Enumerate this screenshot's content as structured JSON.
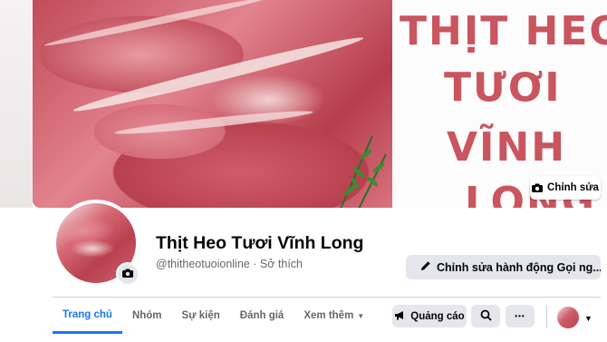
{
  "cover": {
    "text_lines": [
      "THỊT HEO",
      "TƯƠI",
      "VĨNH",
      "LONG"
    ],
    "edit_label": "Chỉnh sửa"
  },
  "profile": {
    "name": "Thịt Heo Tươi Vĩnh Long",
    "username": "@thitheotuoionline",
    "separator": "·",
    "category": "Sở thích"
  },
  "actions": {
    "edit_action_label": "Chỉnh sửa hành động Gọi ng..."
  },
  "tabs": [
    {
      "label": "Trang chủ",
      "active": true
    },
    {
      "label": "Nhóm"
    },
    {
      "label": "Sự kiện"
    },
    {
      "label": "Đánh giá"
    },
    {
      "label": "Xem thêm"
    }
  ],
  "toolbar": {
    "ads_label": "Quảng cáo",
    "more_glyph": "•••",
    "caret": "▼"
  },
  "icons": {
    "camera": "camera-icon",
    "pencil": "pencil-icon",
    "megaphone": "megaphone-icon",
    "search": "search-icon",
    "more": "more-icon",
    "caret": "caret-down-icon"
  },
  "colors": {
    "accent": "#1877f2",
    "cover_text": "#c9555f",
    "button_gray": "#e4e6eb"
  }
}
